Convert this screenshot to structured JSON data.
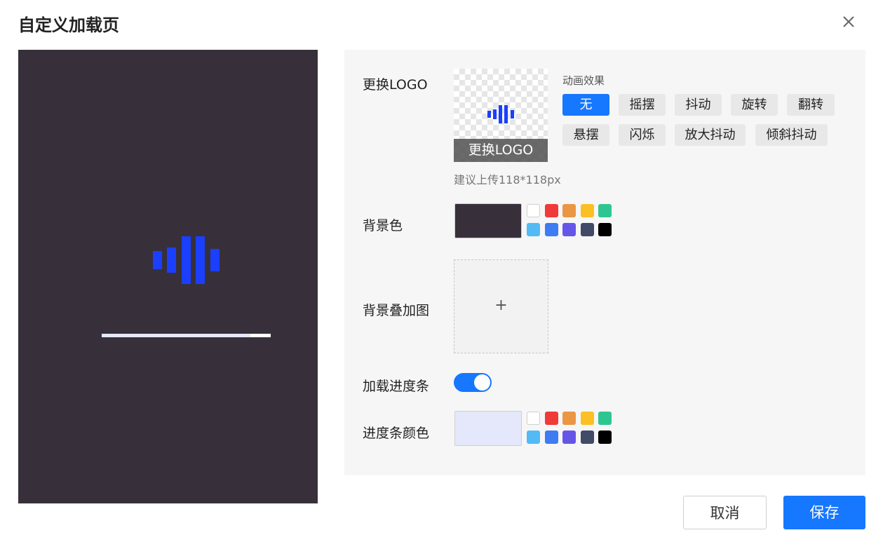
{
  "dialog": {
    "title": "自定义加载页"
  },
  "preview": {
    "progress": 0.88,
    "background_color": "#37303b",
    "logo_color": "#1a3fff",
    "bar_color": "#e4e8fa"
  },
  "logo": {
    "label": "更换LOGO",
    "overlay_text": "更换LOGO",
    "hint": "建议上传118*118px"
  },
  "animation": {
    "title": "动画效果",
    "options": [
      "无",
      "摇摆",
      "抖动",
      "旋转",
      "翻转",
      "悬摆",
      "闪烁",
      "放大抖动",
      "倾斜抖动"
    ],
    "selected": "无"
  },
  "background": {
    "label": "背景色",
    "current": "#37303b",
    "palette": [
      "#ffffff",
      "#f03a3a",
      "#eb9643",
      "#fcbf24",
      "#2ec690",
      "#52bbf5",
      "#3d7cf3",
      "#6656e8",
      "#414a66",
      "#000000"
    ]
  },
  "overlay_image": {
    "label": "背景叠加图",
    "plus": "+"
  },
  "progress_bar": {
    "label": "加载进度条",
    "enabled": true
  },
  "progress_color": {
    "label": "进度条颜色",
    "current": "#e4e8fa",
    "palette": [
      "#ffffff",
      "#f03a3a",
      "#eb9643",
      "#fcbf24",
      "#2ec690",
      "#52bbf5",
      "#3d7cf3",
      "#6656e8",
      "#414a66",
      "#000000"
    ]
  },
  "footer": {
    "cancel": "取消",
    "save": "保存"
  }
}
